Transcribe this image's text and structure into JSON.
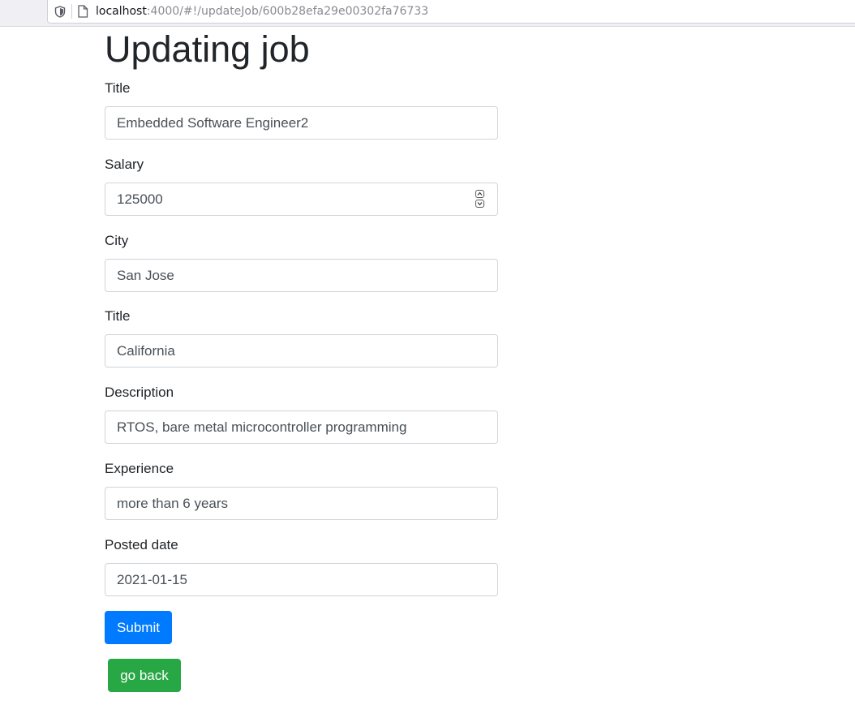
{
  "browser": {
    "url_host": "localhost",
    "url_path": ":4000/#!/updateJob/600b28efa29e00302fa76733"
  },
  "page": {
    "heading": "Updating job"
  },
  "form": {
    "title": {
      "label": "Title",
      "value": "Embedded Software Engineer2"
    },
    "salary": {
      "label": "Salary",
      "value": "125000"
    },
    "city": {
      "label": "City",
      "value": "San Jose"
    },
    "state": {
      "label": "Title",
      "value": "California"
    },
    "description": {
      "label": "Description",
      "value": "RTOS, bare metal microcontroller programming"
    },
    "experience": {
      "label": "Experience",
      "value": "more than 6 years"
    },
    "posted_date": {
      "label": "Posted date",
      "value": "2021-01-15"
    }
  },
  "buttons": {
    "submit": "Submit",
    "go_back": "go back"
  },
  "colors": {
    "primary": "#007bff",
    "success": "#28a745"
  }
}
